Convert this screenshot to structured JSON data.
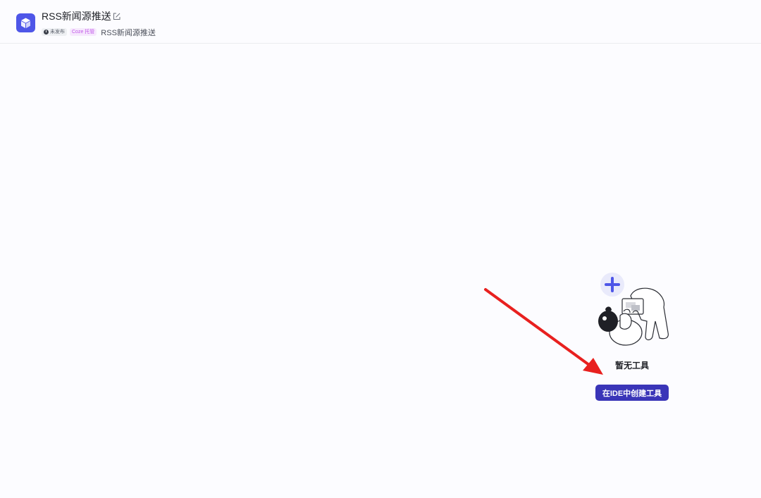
{
  "header": {
    "title": "RSS新闻源推送",
    "status_badge": "未发布",
    "hosted_badge": "Coze 托管",
    "subtitle": "RSS新闻源推送"
  },
  "empty_state": {
    "title": "暂无工具",
    "create_button_label": "在IDE中创建工具"
  },
  "colors": {
    "accent": "#4e56e8",
    "button": "#3a35b8",
    "arrow": "#e8201f"
  },
  "icons": {
    "app": "cube-icon",
    "edit": "edit-icon",
    "status": "clock-icon"
  }
}
